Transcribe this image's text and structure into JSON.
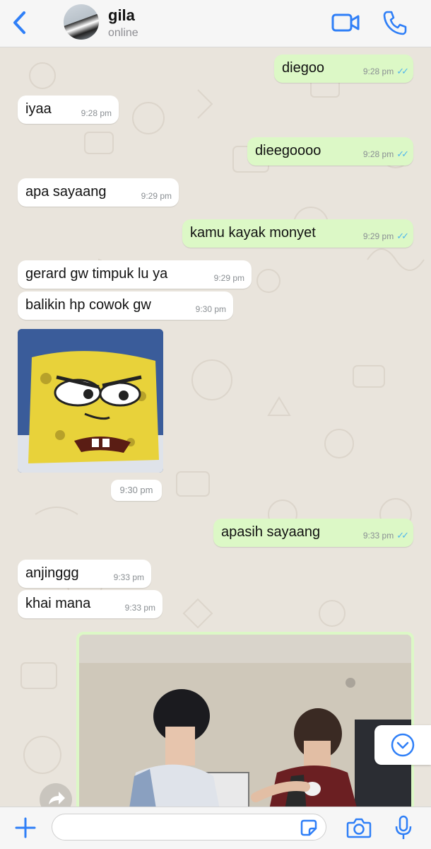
{
  "header": {
    "contact_name": "gila",
    "status": "online"
  },
  "icons": {
    "back": "chevron-left-icon",
    "video": "video-camera-icon",
    "call": "phone-icon",
    "add": "plus-icon",
    "sticker": "sticker-icon",
    "camera": "camera-icon",
    "mic": "microphone-icon",
    "scroll": "chevron-down-circle-icon",
    "forward": "forward-icon"
  },
  "colors": {
    "accent": "#2f7ff7",
    "outgoing_bubble": "#dcf8c6",
    "incoming_bubble": "#ffffff",
    "read_ticks": "#4fb6ec"
  },
  "messages": [
    {
      "dir": "out",
      "text": "diegoo",
      "time": "9:28 pm",
      "ticks": "✓✓"
    },
    {
      "dir": "in",
      "text": "iyaa",
      "time": "9:28 pm"
    },
    {
      "dir": "out",
      "text": "dieegoooo",
      "time": "9:28 pm",
      "ticks": "✓✓"
    },
    {
      "dir": "in",
      "text": "apa sayaang",
      "time": "9:29 pm"
    },
    {
      "dir": "out",
      "text": "kamu kayak monyet",
      "time": "9:29 pm",
      "ticks": "✓✓"
    },
    {
      "dir": "in",
      "text": "gerard gw timpuk lu ya",
      "time": "9:29 pm"
    },
    {
      "dir": "in",
      "text": "balikin hp cowok gw",
      "time": "9:30 pm"
    },
    {
      "dir": "out",
      "text": "apasih sayaang",
      "time": "9:33 pm",
      "ticks": "✓✓"
    },
    {
      "dir": "in",
      "text": "anjinggg",
      "time": "9:33 pm"
    },
    {
      "dir": "in",
      "text": "khai mana",
      "time": "9:33 pm"
    }
  ],
  "sticker_time": "9:30 pm"
}
